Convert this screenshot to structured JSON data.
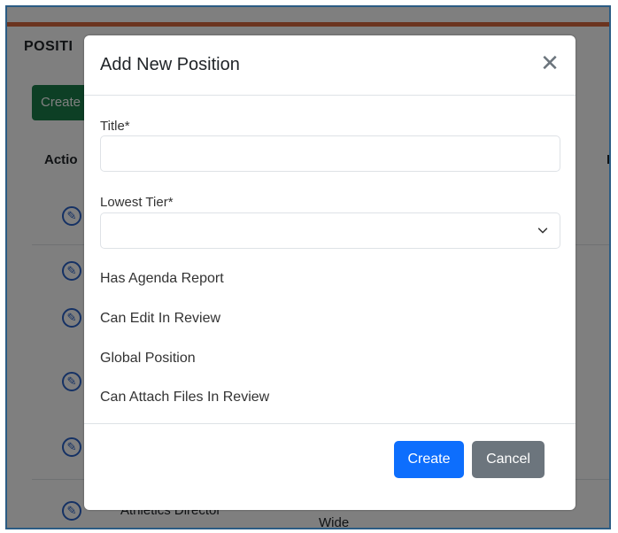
{
  "background": {
    "heading": "POSITI",
    "create_button": "Create",
    "columns": {
      "action": "Actio",
      "ed": "Ed"
    },
    "rows": [
      {
        "name": "Athletics Director",
        "scope": "Wide"
      }
    ]
  },
  "modal": {
    "title": "Add New Position",
    "close_symbol": "✕",
    "fields": {
      "title_label": "Title*",
      "title_value": "",
      "tier_label": "Lowest Tier*",
      "tier_value": ""
    },
    "checkboxes": [
      {
        "label": "Has Agenda Report"
      },
      {
        "label": "Can Edit In Review"
      },
      {
        "label": "Global Position"
      },
      {
        "label": "Can Attach Files In Review"
      }
    ],
    "buttons": {
      "create": "Create",
      "cancel": "Cancel"
    }
  },
  "colors": {
    "accent_bar": "#d6693e",
    "frame_border": "#2b5c84",
    "primary": "#0d6efd",
    "secondary": "#6c757d",
    "success": "#1a7f4b"
  },
  "icons": {
    "edit": "edit-icon",
    "close": "close-icon",
    "chevron": "chevron-down-icon"
  }
}
